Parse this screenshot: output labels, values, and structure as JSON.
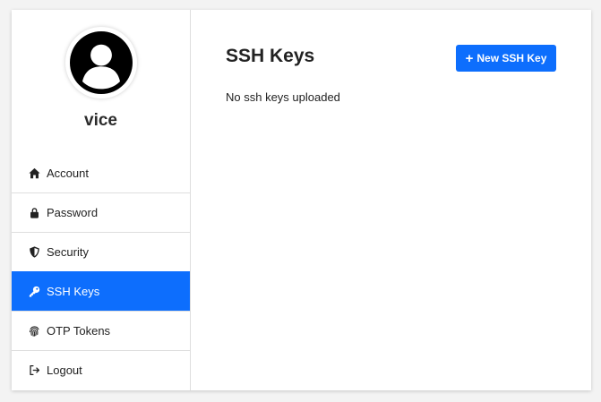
{
  "profile": {
    "username": "vice",
    "avatar_icon": "user-circle-icon"
  },
  "sidebar": {
    "items": [
      {
        "label": "Account",
        "icon": "home-icon",
        "active": false
      },
      {
        "label": "Password",
        "icon": "lock-icon",
        "active": false
      },
      {
        "label": "Security",
        "icon": "shield-icon",
        "active": false
      },
      {
        "label": "SSH Keys",
        "icon": "key-icon",
        "active": true
      },
      {
        "label": "OTP Tokens",
        "icon": "fingerprint-icon",
        "active": false
      },
      {
        "label": "Logout",
        "icon": "logout-icon",
        "active": false
      }
    ]
  },
  "main": {
    "title": "SSH Keys",
    "new_button_label": "New SSH Key",
    "new_button_icon": "plus-icon",
    "empty_message": "No ssh keys uploaded"
  },
  "colors": {
    "accent": "#0d6efd",
    "background": "#f3f3f3",
    "card": "#ffffff",
    "divider": "#dedede"
  }
}
